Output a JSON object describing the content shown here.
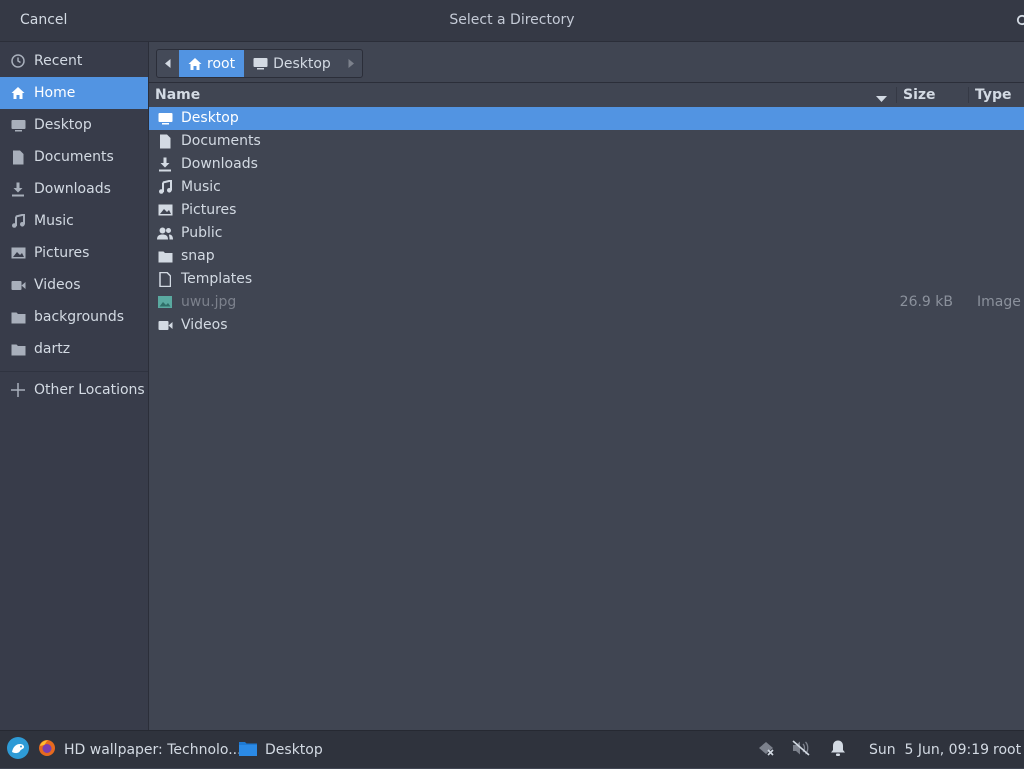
{
  "header": {
    "cancel_label": "Cancel",
    "title": "Select a Directory"
  },
  "sidebar": {
    "items": [
      {
        "label": "Recent",
        "icon": "clock-icon"
      },
      {
        "label": "Home",
        "icon": "home-icon"
      },
      {
        "label": "Desktop",
        "icon": "desktop-icon"
      },
      {
        "label": "Documents",
        "icon": "document-icon"
      },
      {
        "label": "Downloads",
        "icon": "download-icon"
      },
      {
        "label": "Music",
        "icon": "music-icon"
      },
      {
        "label": "Pictures",
        "icon": "picture-icon"
      },
      {
        "label": "Videos",
        "icon": "video-icon"
      },
      {
        "label": "backgrounds",
        "icon": "folder-icon"
      },
      {
        "label": "dartz",
        "icon": "folder-icon"
      }
    ],
    "other_locations": "Other Locations",
    "active": "Home"
  },
  "pathbar": {
    "segments": [
      {
        "label": "root",
        "icon": "home-icon"
      },
      {
        "label": "Desktop",
        "icon": "desktop-icon"
      }
    ]
  },
  "file_list": {
    "columns": {
      "name": "Name",
      "size": "Size",
      "type": "Type"
    },
    "rows": [
      {
        "name": "Desktop",
        "icon": "desktop-icon",
        "size": "",
        "type": ""
      },
      {
        "name": "Documents",
        "icon": "document-icon",
        "size": "",
        "type": ""
      },
      {
        "name": "Downloads",
        "icon": "download-icon",
        "size": "",
        "type": ""
      },
      {
        "name": "Music",
        "icon": "music-icon",
        "size": "",
        "type": ""
      },
      {
        "name": "Pictures",
        "icon": "picture-icon",
        "size": "",
        "type": ""
      },
      {
        "name": "Public",
        "icon": "people-icon",
        "size": "",
        "type": ""
      },
      {
        "name": "snap",
        "icon": "folder-icon",
        "size": "",
        "type": ""
      },
      {
        "name": "Templates",
        "icon": "template-icon",
        "size": "",
        "type": ""
      },
      {
        "name": "uwu.jpg",
        "icon": "image-file-icon",
        "size": "26.9 kB",
        "type": "Image"
      },
      {
        "name": "Videos",
        "icon": "video-icon",
        "size": "",
        "type": ""
      }
    ],
    "selected": "Desktop"
  },
  "taskbar": {
    "firefox_window": "HD wallpaper: Technolo...",
    "files_window": "Desktop",
    "clock": "Sun  5 Jun, 09:19",
    "user": "root"
  },
  "colors": {
    "accent": "#5294e2",
    "background": "#404552",
    "sidebar": "#383c4a",
    "header": "#353945",
    "taskbar": "#2f333d"
  }
}
